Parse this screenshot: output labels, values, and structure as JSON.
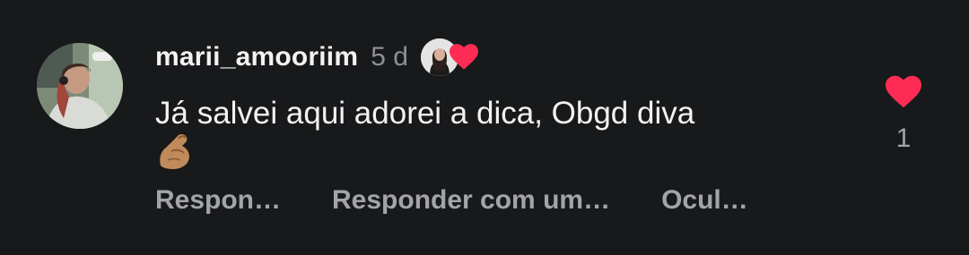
{
  "comment": {
    "username": "marii_amooriim",
    "time": "5 d",
    "text_line1": "Já salvei aqui adorei a dica, Obgd diva",
    "emoji": "🤌",
    "like_count": "1"
  },
  "actions": {
    "reply": "Respon…",
    "reply_with": "Responder com um…",
    "hide": "Ocul…"
  },
  "colors": {
    "background": "#18191b",
    "heart": "#fe2c55",
    "primary_text": "#f2f2f2",
    "secondary_text": "#a3a4a8"
  },
  "icons": {
    "like": "heart-icon",
    "creator_liked": "creator-liked-heart-icon"
  }
}
